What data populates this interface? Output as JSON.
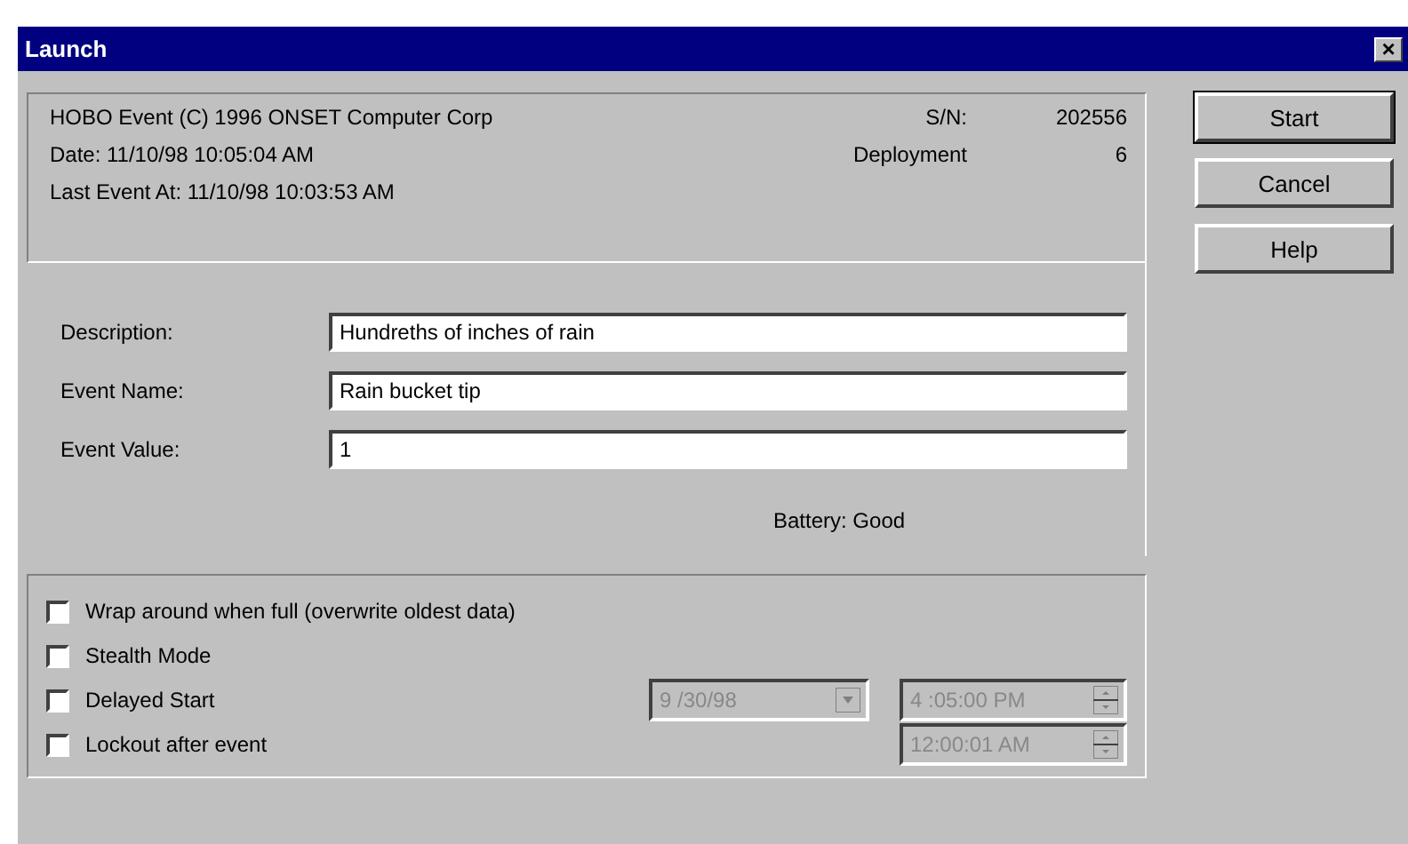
{
  "window": {
    "title": "Launch",
    "close": "×"
  },
  "info": {
    "product": "HOBO Event (C) 1996 ONSET Computer Corp",
    "date": "Date:  11/10/98  10:05:04 AM",
    "last_event": "Last Event At:  11/10/98  10:03:53 AM",
    "sn_label": "S/N:",
    "sn_value": "202556",
    "deployment_label": "Deployment",
    "deployment_value": "6"
  },
  "fields": [
    {
      "label": "Description:",
      "value": "Hundreths of inches of rain"
    },
    {
      "label": "Event Name:",
      "value": "Rain bucket tip"
    },
    {
      "label": "Event Value:",
      "value": "1"
    }
  ],
  "battery": "Battery: Good",
  "options": [
    {
      "label": "Wrap around when full (overwrite oldest data)",
      "checked": false
    },
    {
      "label": "Stealth Mode",
      "checked": false
    },
    {
      "label": "Delayed Start",
      "checked": false,
      "date": {
        "value": "9 /30/98",
        "disabled": true
      },
      "time": {
        "value": "4 :05:00 PM",
        "disabled": true
      }
    },
    {
      "label": "Lockout after event",
      "checked": false,
      "time": {
        "value": "12:00:01 AM",
        "disabled": true
      }
    }
  ],
  "buttons": [
    {
      "label": "Start",
      "default": true
    },
    {
      "label": "Cancel",
      "default": false
    },
    {
      "label": "Help",
      "default": false
    }
  ]
}
